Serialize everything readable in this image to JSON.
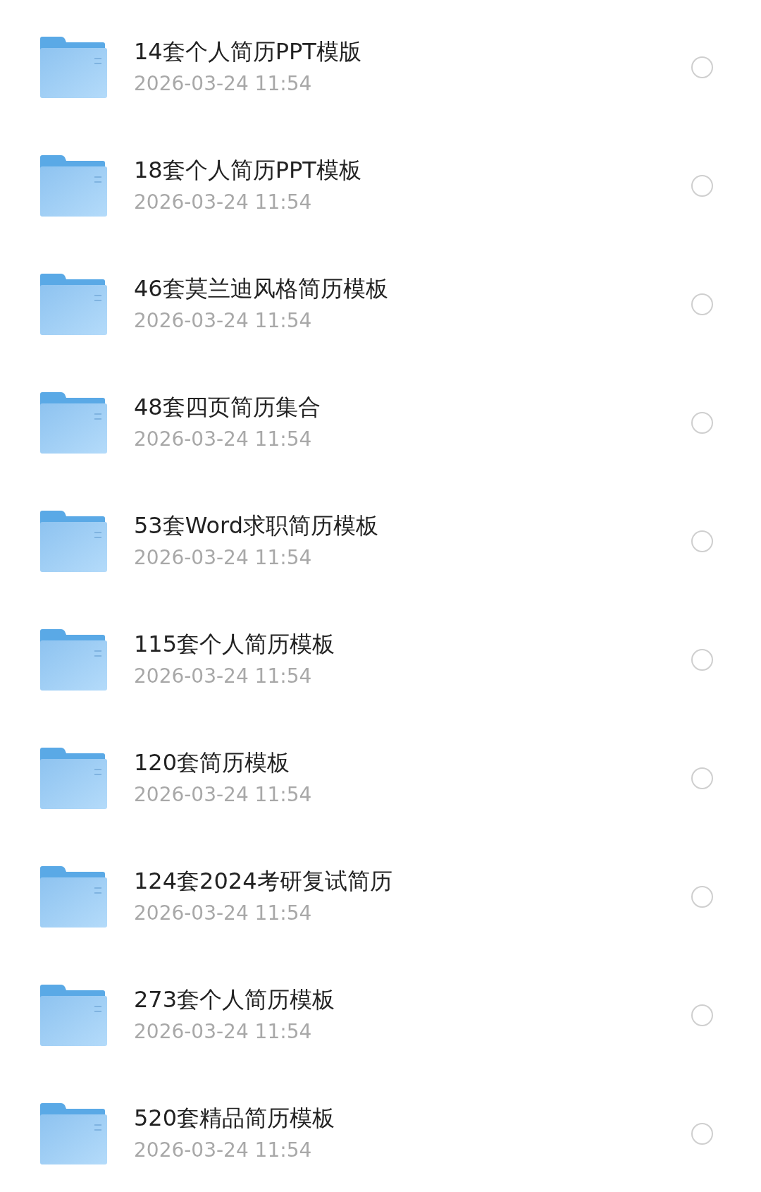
{
  "files": [
    {
      "name": "14套个人简历PPT模版",
      "date": "2026-03-24 11:54",
      "selected": false
    },
    {
      "name": "18套个人简历PPT模板",
      "date": "2026-03-24 11:54",
      "selected": false
    },
    {
      "name": "46套莫兰迪风格简历模板",
      "date": "2026-03-24 11:54",
      "selected": false
    },
    {
      "name": "48套四页简历集合",
      "date": "2026-03-24 11:54",
      "selected": false
    },
    {
      "name": "53套Word求职简历模板",
      "date": "2026-03-24 11:54",
      "selected": false
    },
    {
      "name": "115套个人简历模板",
      "date": "2026-03-24 11:54",
      "selected": false
    },
    {
      "name": "120套简历模板",
      "date": "2026-03-24 11:54",
      "selected": false
    },
    {
      "name": "124套2024考研复试简历",
      "date": "2026-03-24 11:54",
      "selected": false
    },
    {
      "name": "273套个人简历模板",
      "date": "2026-03-24 11:54",
      "selected": false
    },
    {
      "name": "520套精品简历模板",
      "date": "2026-03-24 11:54",
      "selected": false
    }
  ]
}
